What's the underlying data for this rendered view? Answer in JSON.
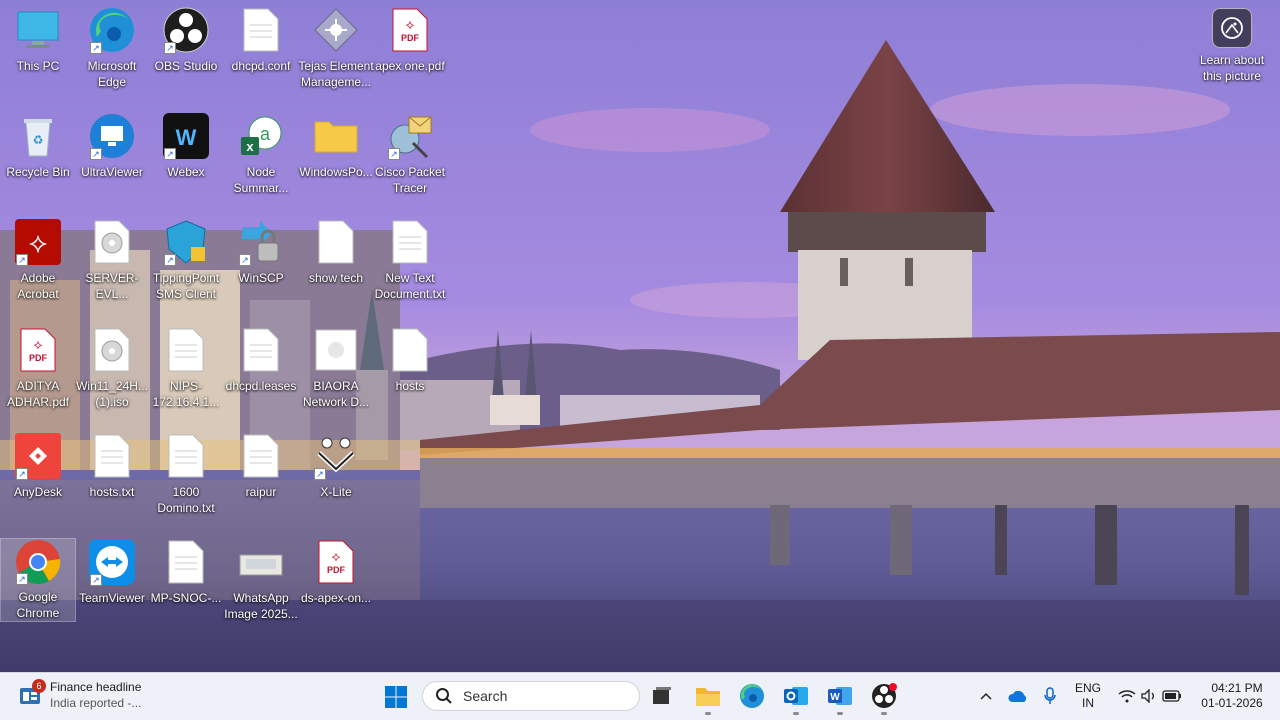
{
  "desktop": {
    "icons": [
      {
        "label": "This PC"
      },
      {
        "label": "Microsoft Edge"
      },
      {
        "label": "OBS Studio"
      },
      {
        "label": "dhcpd.conf"
      },
      {
        "label": "Tejas Element Manageme..."
      },
      {
        "label": "apex one.pdf"
      },
      {
        "label": "Recycle Bin"
      },
      {
        "label": "UltraViewer"
      },
      {
        "label": "Webex"
      },
      {
        "label": "Node Summar..."
      },
      {
        "label": "WindowsPo..."
      },
      {
        "label": "Cisco Packet Tracer"
      },
      {
        "label": "Adobe Acrobat"
      },
      {
        "label": "SERVER-EVL..."
      },
      {
        "label": "TippingPoint SMS Client"
      },
      {
        "label": "WinSCP"
      },
      {
        "label": "show tech"
      },
      {
        "label": "New Text Document.txt"
      },
      {
        "label": "ADITYA ADHAR.pdf"
      },
      {
        "label": "Win11_24H... (1).iso"
      },
      {
        "label": "NIPS-172.16.4.1..."
      },
      {
        "label": "dhcpd.leases"
      },
      {
        "label": "BIAORA Network D..."
      },
      {
        "label": "hosts"
      },
      {
        "label": "AnyDesk"
      },
      {
        "label": "hosts.txt"
      },
      {
        "label": "1600 Domino.txt"
      },
      {
        "label": "raipur"
      },
      {
        "label": "X-Lite"
      },
      {
        "label": "Google Chrome"
      },
      {
        "label": "TeamViewer"
      },
      {
        "label": "MP-SNOC-..."
      },
      {
        "label": "WhatsApp Image 2025..."
      },
      {
        "label": "ds-apex-on..."
      }
    ],
    "learn_label": "Learn about this picture"
  },
  "taskbar": {
    "weather": {
      "badge": "6",
      "title": "Finance headline",
      "subtitle": "India reported -..."
    },
    "search_label": "Search",
    "lang_top": "ENG",
    "lang_bottom": "IN",
    "time": "04:21 PM",
    "date": "01-01-2026"
  },
  "colors": {
    "taskbar_bg": "#eef1f7",
    "accent": "#0078d4",
    "pdf_red": "#c8102e"
  }
}
